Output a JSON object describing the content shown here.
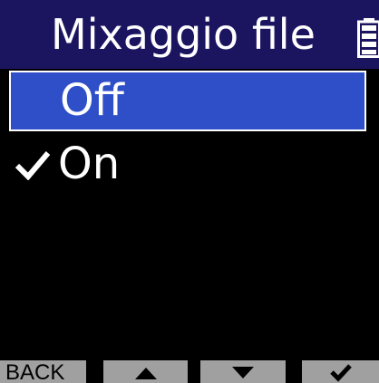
{
  "header": {
    "title": "Mixaggio file",
    "status_icon": "battery-icon"
  },
  "menu": {
    "items": [
      {
        "label": "Off",
        "highlighted": true,
        "checked": false
      },
      {
        "label": "On",
        "highlighted": false,
        "checked": true
      }
    ],
    "check_icon": "checkmark-icon"
  },
  "softkeys": {
    "back_label": "BACK",
    "up_icon": "triangle-up-icon",
    "down_icon": "triangle-down-icon",
    "enter_icon": "checkmark-icon"
  },
  "colors": {
    "screen_background": "#000000",
    "title_bar": "#1b1560",
    "highlight": "#2f4fc9",
    "text": "#ffffff",
    "softkey_background": "#a0a0a0",
    "softkey_text": "#000000"
  }
}
